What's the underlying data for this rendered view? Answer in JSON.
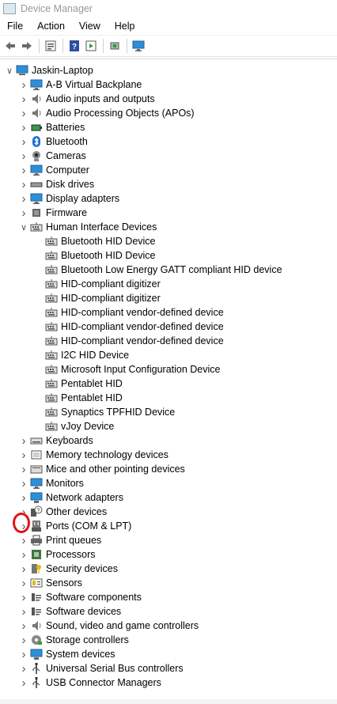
{
  "window": {
    "title": "Device Manager"
  },
  "menu": [
    "File",
    "Action",
    "View",
    "Help"
  ],
  "toolbar": [
    {
      "name": "back-icon"
    },
    {
      "name": "forward-icon"
    },
    {
      "sep": true
    },
    {
      "name": "properties-icon"
    },
    {
      "sep": true
    },
    {
      "name": "help-icon"
    },
    {
      "name": "run-icon"
    },
    {
      "sep": true
    },
    {
      "name": "scan-hardware-icon"
    },
    {
      "sep": true
    },
    {
      "name": "monitor-icon"
    }
  ],
  "tree": {
    "root": "Jaskin-Laptop",
    "categories_before": [
      {
        "label": "A-B Virtual Backplane",
        "icon": "monitor-icon"
      },
      {
        "label": "Audio inputs and outputs",
        "icon": "speaker-icon"
      },
      {
        "label": "Audio Processing Objects (APOs)",
        "icon": "speaker-icon"
      },
      {
        "label": "Batteries",
        "icon": "battery-icon"
      },
      {
        "label": "Bluetooth",
        "icon": "bluetooth-icon"
      },
      {
        "label": "Cameras",
        "icon": "camera-icon"
      },
      {
        "label": "Computer",
        "icon": "monitor-icon"
      },
      {
        "label": "Disk drives",
        "icon": "disk-icon"
      },
      {
        "label": "Display adapters",
        "icon": "monitor-icon"
      },
      {
        "label": "Firmware",
        "icon": "chip-icon"
      }
    ],
    "expanded": {
      "label": "Human Interface Devices",
      "icon": "hid-icon",
      "children": [
        "Bluetooth HID Device",
        "Bluetooth HID Device",
        "Bluetooth Low Energy GATT compliant HID device",
        "HID-compliant digitizer",
        "HID-compliant digitizer",
        "HID-compliant vendor-defined device",
        "HID-compliant vendor-defined device",
        "HID-compliant vendor-defined device",
        "I2C HID Device",
        "Microsoft Input Configuration Device",
        "Pentablet HID",
        "Pentablet HID",
        "Synaptics TPFHID Device",
        "vJoy Device"
      ]
    },
    "categories_after": [
      {
        "label": "Keyboards",
        "icon": "keyboard-icon"
      },
      {
        "label": "Memory technology devices",
        "icon": "memory-icon"
      },
      {
        "label": "Mice and other pointing devices",
        "icon": "mouse-icon"
      },
      {
        "label": "Monitors",
        "icon": "monitor-icon"
      },
      {
        "label": "Network adapters",
        "icon": "network-icon"
      },
      {
        "label": "Other devices",
        "icon": "unknown-device-icon"
      },
      {
        "label": "Ports (COM & LPT)",
        "icon": "port-icon"
      },
      {
        "label": "Print queues",
        "icon": "printer-icon"
      },
      {
        "label": "Processors",
        "icon": "cpu-icon"
      },
      {
        "label": "Security devices",
        "icon": "security-icon"
      },
      {
        "label": "Sensors",
        "icon": "sensor-icon"
      },
      {
        "label": "Software components",
        "icon": "software-icon"
      },
      {
        "label": "Software devices",
        "icon": "software-icon"
      },
      {
        "label": "Sound, video and game controllers",
        "icon": "speaker-icon"
      },
      {
        "label": "Storage controllers",
        "icon": "storage-icon"
      },
      {
        "label": "System devices",
        "icon": "system-icon"
      },
      {
        "label": "Universal Serial Bus controllers",
        "icon": "usb-icon"
      },
      {
        "label": "USB Connector Managers",
        "icon": "usb-icon"
      }
    ]
  },
  "colors": {
    "annotation_circle": "#e0131a",
    "selection": "#cce8ff"
  }
}
